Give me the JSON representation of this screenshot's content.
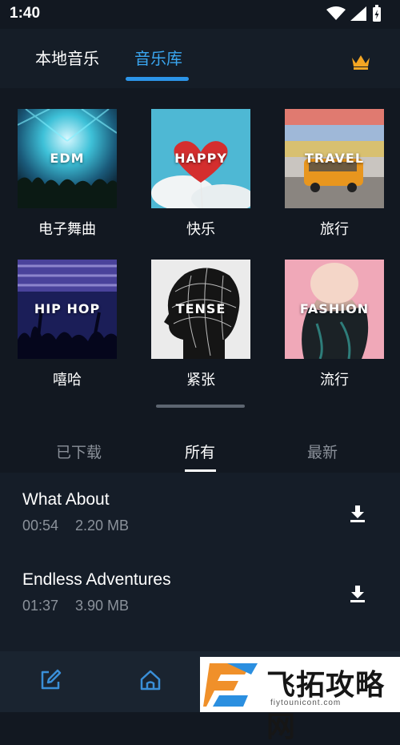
{
  "status_bar": {
    "time": "1:40"
  },
  "header": {
    "tabs": [
      {
        "label": "本地音乐",
        "active": false
      },
      {
        "label": "音乐库",
        "active": true
      }
    ],
    "accent_color": "#2c95e8",
    "crown_color": "#f5a623"
  },
  "genres": [
    {
      "overlay": "EDM",
      "label": "电子舞曲"
    },
    {
      "overlay": "HAPPY",
      "label": "快乐"
    },
    {
      "overlay": "TRAVEL",
      "label": "旅行"
    },
    {
      "overlay": "HIP HOP",
      "label": "嘻哈"
    },
    {
      "overlay": "TENSE",
      "label": "紧张"
    },
    {
      "overlay": "FASHION",
      "label": "流行"
    }
  ],
  "filter_tabs": [
    {
      "label": "已下载",
      "active": false
    },
    {
      "label": "所有",
      "active": true
    },
    {
      "label": "最新",
      "active": false
    }
  ],
  "tracks": [
    {
      "title": "What About",
      "duration": "00:54",
      "size": "2.20 MB"
    },
    {
      "title": "Endless Adventures",
      "duration": "01:37",
      "size": "3.90 MB"
    }
  ],
  "bottom_nav": {
    "icons": [
      "edit-icon",
      "home-icon"
    ]
  },
  "watermark": {
    "text": "飞拓攻略网",
    "url": "fiytounicont.com"
  }
}
